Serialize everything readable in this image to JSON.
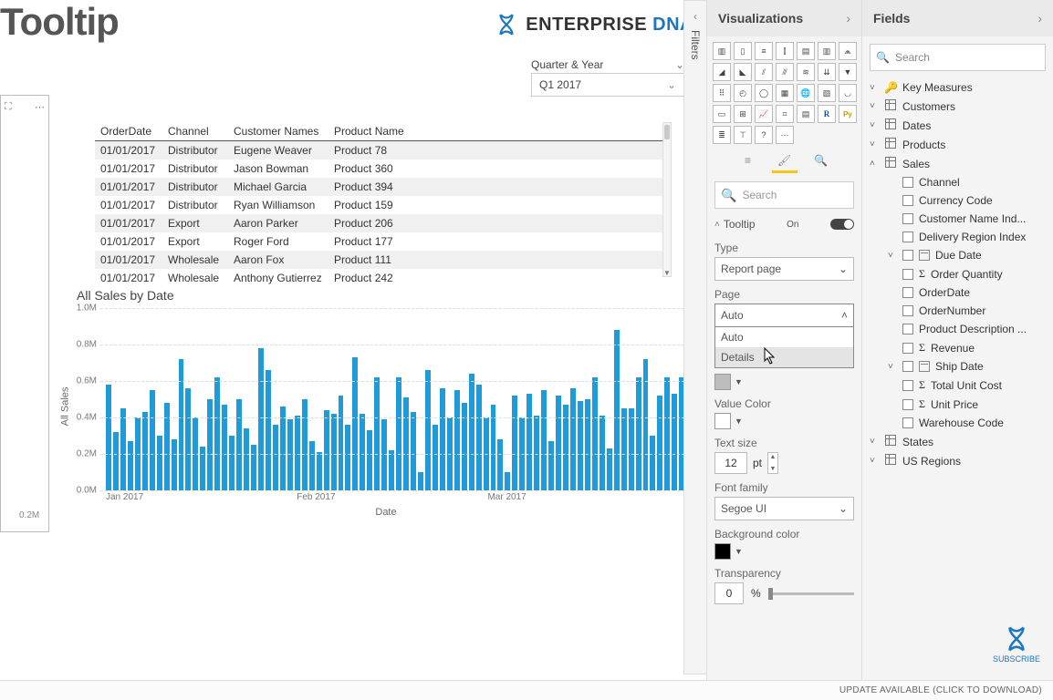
{
  "page": {
    "title": "Tooltip"
  },
  "brand": {
    "text": "ENTERPRISE",
    "accent": "DNA"
  },
  "slicer": {
    "label": "Quarter & Year",
    "value": "Q1 2017"
  },
  "table": {
    "columns": [
      "OrderDate",
      "Channel",
      "Customer Names",
      "Product Name"
    ],
    "rows": [
      [
        "01/01/2017",
        "Distributor",
        "Eugene Weaver",
        "Product 78"
      ],
      [
        "01/01/2017",
        "Distributor",
        "Jason Bowman",
        "Product 360"
      ],
      [
        "01/01/2017",
        "Distributor",
        "Michael Garcia",
        "Product 394"
      ],
      [
        "01/01/2017",
        "Distributor",
        "Ryan Williamson",
        "Product 159"
      ],
      [
        "01/01/2017",
        "Export",
        "Aaron Parker",
        "Product 206"
      ],
      [
        "01/01/2017",
        "Export",
        "Roger Ford",
        "Product 177"
      ],
      [
        "01/01/2017",
        "Wholesale",
        "Aaron Fox",
        "Product 111"
      ],
      [
        "01/01/2017",
        "Wholesale",
        "Anthony Gutierrez",
        "Product 242"
      ]
    ]
  },
  "chart_data": {
    "type": "bar",
    "title": "All Sales by Date",
    "ylabel": "All Sales",
    "xlabel": "Date",
    "ylim": [
      0,
      1.0
    ],
    "y_ticks": [
      "0.0M",
      "0.2M",
      "0.4M",
      "0.6M",
      "0.8M",
      "1.0M"
    ],
    "x_ticks": [
      "Jan 2017",
      "Feb 2017",
      "Mar 2017"
    ],
    "values": [
      0.58,
      0.32,
      0.45,
      0.27,
      0.4,
      0.43,
      0.55,
      0.3,
      0.48,
      0.28,
      0.72,
      0.56,
      0.4,
      0.24,
      0.5,
      0.62,
      0.47,
      0.3,
      0.5,
      0.34,
      0.25,
      0.78,
      0.66,
      0.36,
      0.46,
      0.39,
      0.41,
      0.5,
      0.27,
      0.21,
      0.44,
      0.42,
      0.52,
      0.36,
      0.73,
      0.42,
      0.33,
      0.62,
      0.39,
      0.22,
      0.62,
      0.51,
      0.43,
      0.1,
      0.66,
      0.36,
      0.56,
      0.4,
      0.55,
      0.48,
      0.64,
      0.58,
      0.4,
      0.47,
      0.28,
      0.1,
      0.52,
      0.4,
      0.53,
      0.41,
      0.55,
      0.27,
      0.52,
      0.47,
      0.56,
      0.49,
      0.5,
      0.62,
      0.41,
      0.23,
      0.88,
      0.45,
      0.45,
      0.62,
      0.72,
      0.3,
      0.52,
      0.62,
      0.53,
      0.62
    ]
  },
  "side_visual_tick": "0.2M",
  "panes": {
    "visualizations": "Visualizations",
    "fields": "Fields",
    "filters": "Filters"
  },
  "format": {
    "search_placeholder": "Search",
    "card_title": "Tooltip",
    "card_state": "On",
    "type_label": "Type",
    "type_value": "Report page",
    "page_label": "Page",
    "page_value": "Auto",
    "page_options": [
      "Auto",
      "Details"
    ],
    "value_color_label": "Value Color",
    "text_size_label": "Text size",
    "text_size_value": "12",
    "text_size_unit": "pt",
    "font_family_label": "Font family",
    "font_family_value": "Segoe UI",
    "bg_color_label": "Background color",
    "transparency_label": "Transparency",
    "transparency_value": "0",
    "transparency_unit": "%"
  },
  "fields": {
    "search_placeholder": "Search",
    "tables": [
      {
        "name": "Key Measures",
        "icon": "key",
        "expanded": false
      },
      {
        "name": "Customers",
        "icon": "key-table",
        "expanded": false
      },
      {
        "name": "Dates",
        "icon": "table",
        "expanded": false
      },
      {
        "name": "Products",
        "icon": "table",
        "expanded": false
      },
      {
        "name": "Sales",
        "icon": "table",
        "expanded": true,
        "columns": [
          {
            "name": "Channel",
            "type": "text"
          },
          {
            "name": "Currency Code",
            "type": "text"
          },
          {
            "name": "Customer Name Ind...",
            "type": "text"
          },
          {
            "name": "Delivery Region Index",
            "type": "text"
          },
          {
            "name": "Due Date",
            "type": "date",
            "expandable": true
          },
          {
            "name": "Order Quantity",
            "type": "sum"
          },
          {
            "name": "OrderDate",
            "type": "text"
          },
          {
            "name": "OrderNumber",
            "type": "text"
          },
          {
            "name": "Product Description ...",
            "type": "text"
          },
          {
            "name": "Revenue",
            "type": "sum"
          },
          {
            "name": "Ship Date",
            "type": "date",
            "expandable": true
          },
          {
            "name": "Total Unit Cost",
            "type": "sum"
          },
          {
            "name": "Unit Price",
            "type": "sum"
          },
          {
            "name": "Warehouse Code",
            "type": "text"
          }
        ]
      },
      {
        "name": "States",
        "icon": "table",
        "expanded": false
      },
      {
        "name": "US Regions",
        "icon": "table",
        "expanded": false
      }
    ]
  },
  "subscribe_label": "SUBSCRIBE",
  "status_bar": "UPDATE AVAILABLE (CLICK TO DOWNLOAD)"
}
